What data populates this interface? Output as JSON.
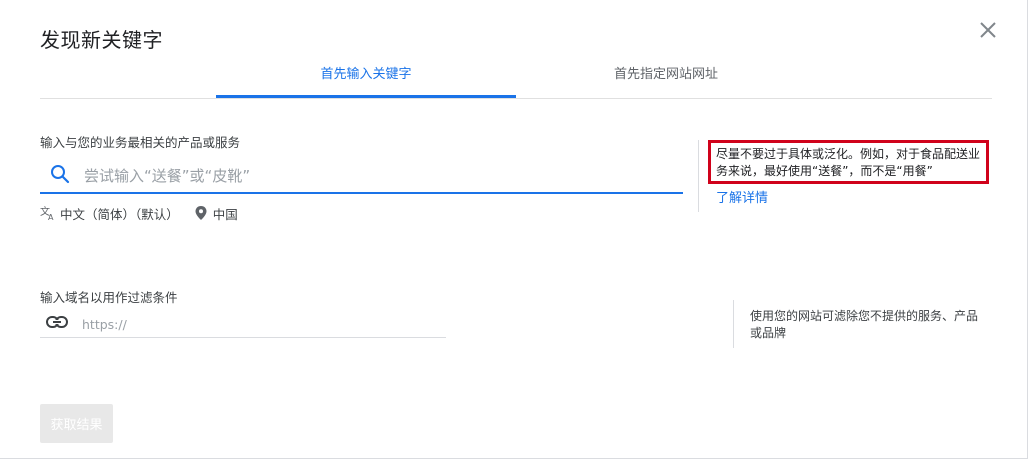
{
  "dialog": {
    "title": "发现新关键字",
    "close_icon": "close-icon"
  },
  "tabs": [
    {
      "label": "首先输入关键字",
      "selected": true
    },
    {
      "label": "首先指定网站网址",
      "selected": false
    }
  ],
  "keywords": {
    "label": "输入与您的业务最相关的产品或服务",
    "placeholder": "尝试输入“送餐”或“皮靴”",
    "value": "",
    "language": "中文（简体）（默认）",
    "location": "中国"
  },
  "keywords_hint": {
    "text": "尽量不要过于具体或泛化。例如，对于食品配送业务来说，最好使用“送餐”，而不是“用餐”",
    "link": "了解详情"
  },
  "domain": {
    "label": "输入域名以用作过滤条件",
    "placeholder": "https://",
    "value": ""
  },
  "domain_hint": {
    "text": "使用您的网站可滤除您不提供的服务、产品或品牌"
  },
  "footer": {
    "submit_label": "获取结果",
    "submit_enabled": false
  },
  "colors": {
    "accent": "#1a73e8",
    "highlight_border": "#d0021b",
    "disabled_button": "#e8e8e8"
  }
}
